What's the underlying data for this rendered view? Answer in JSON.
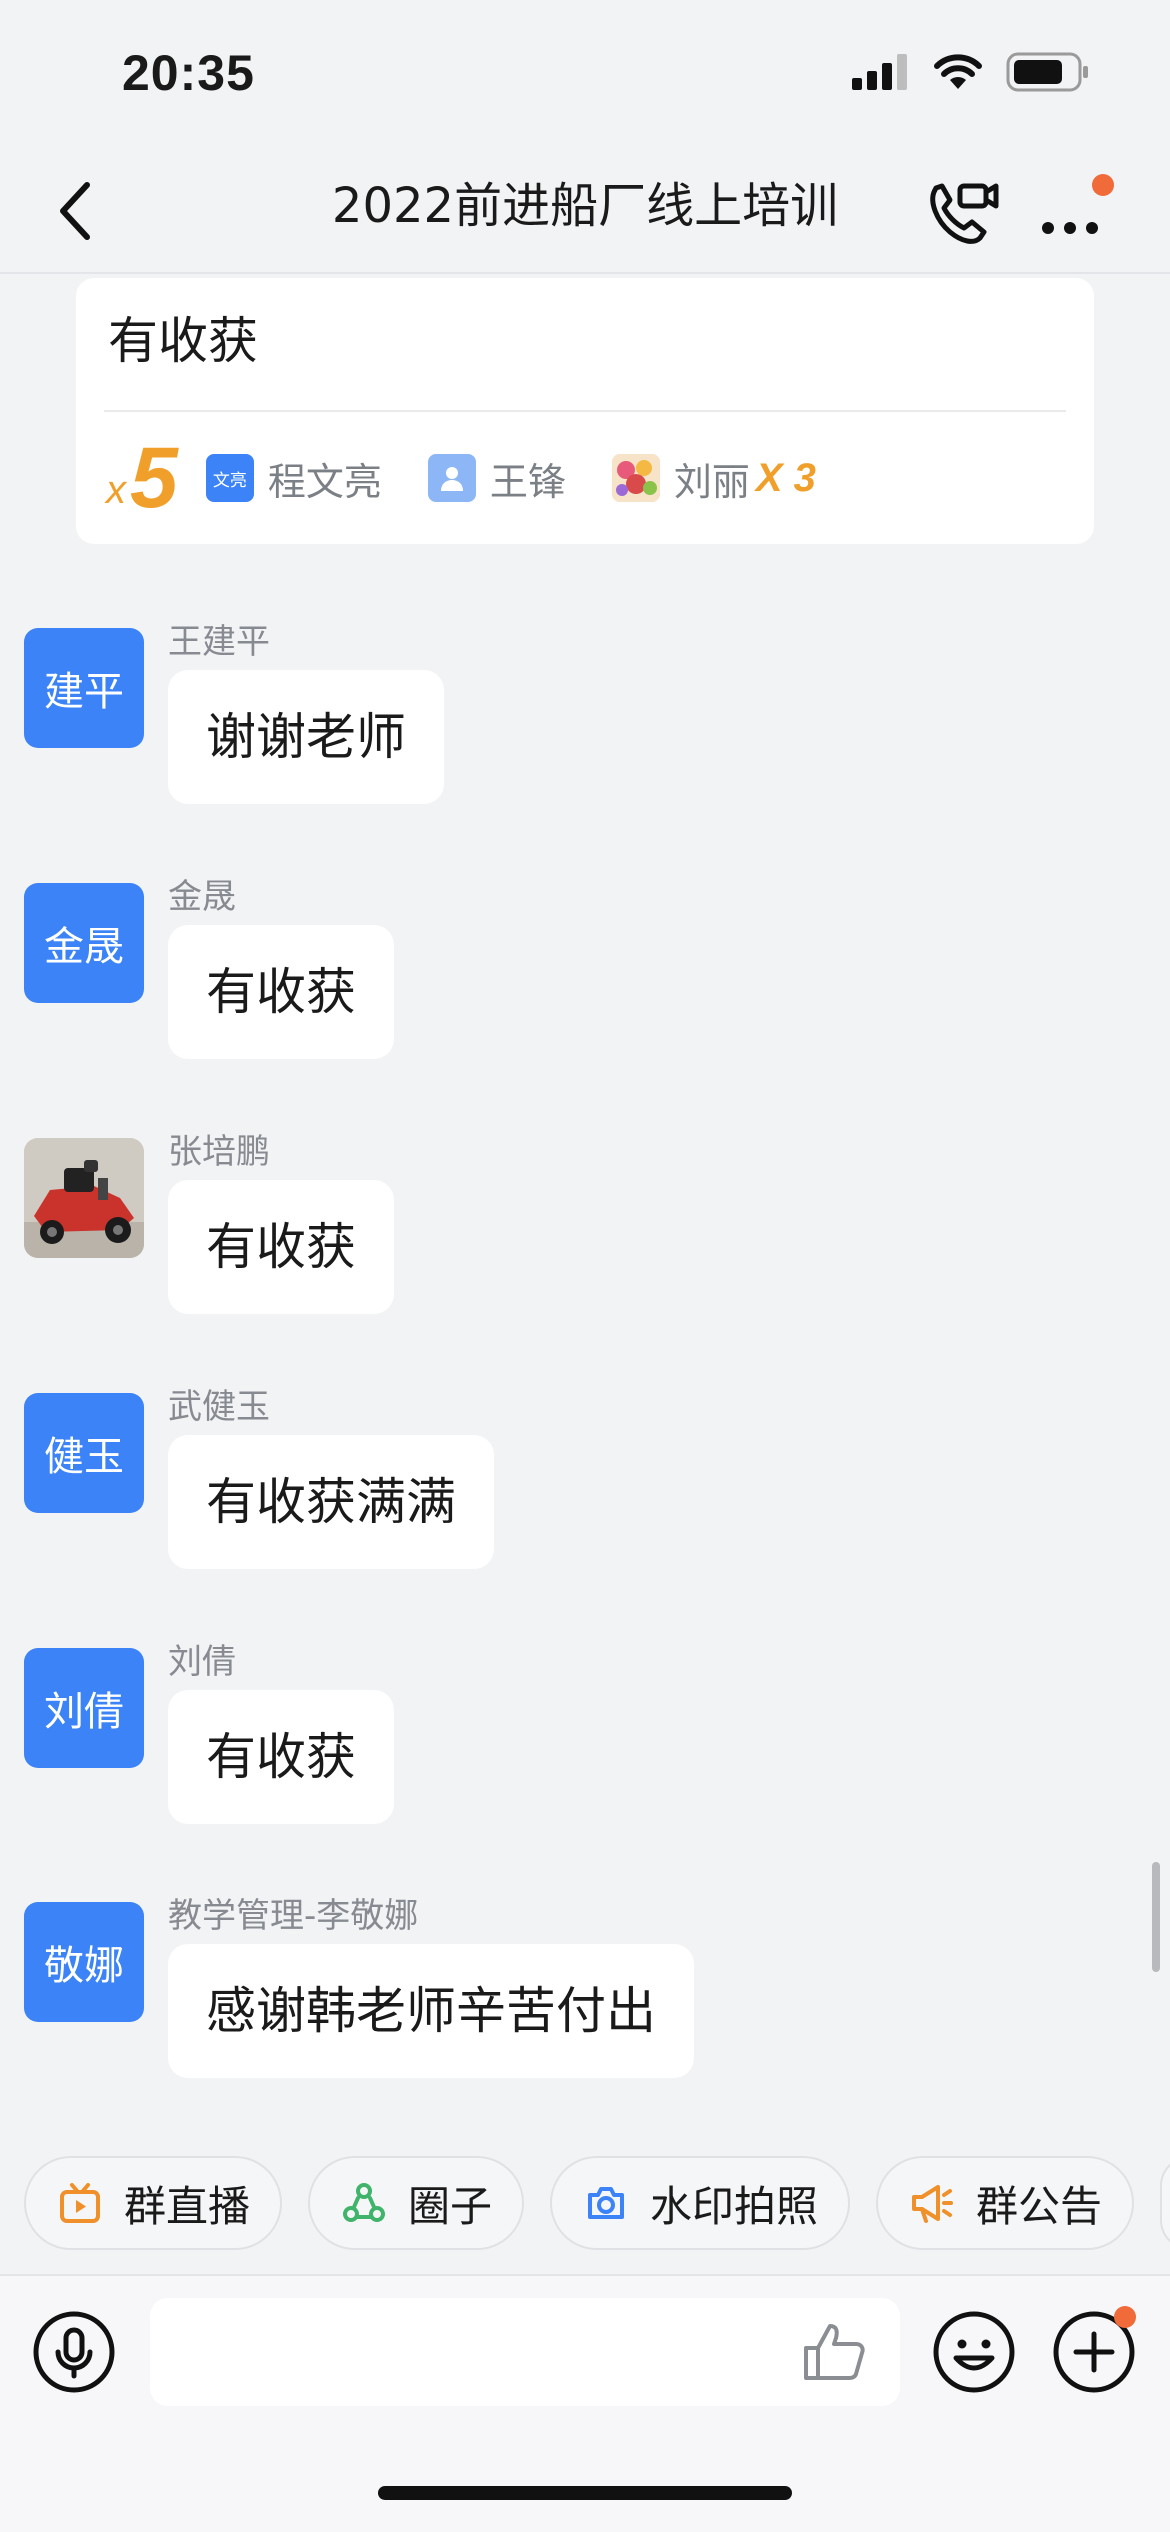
{
  "status_bar": {
    "time": "20:35"
  },
  "header": {
    "title": "2022前进船厂线上培训"
  },
  "reaction_card": {
    "message_text": "有收获",
    "count_prefix": "x",
    "count": "5",
    "reactors": [
      {
        "avatar_text": "文亮",
        "name": "程文亮",
        "extra": ""
      },
      {
        "avatar_text": "",
        "name": "王锋",
        "extra": ""
      },
      {
        "avatar_text": "",
        "name": "刘丽",
        "extra": "X 3"
      }
    ]
  },
  "messages": [
    {
      "avatar_text": "建平",
      "sender": "王建平",
      "text": "谢谢老师"
    },
    {
      "avatar_text": "金晟",
      "sender": "金晟",
      "text": "有收获"
    },
    {
      "avatar_text": "",
      "sender": "张培鹏",
      "text": "有收获"
    },
    {
      "avatar_text": "健玉",
      "sender": "武健玉",
      "text": "有收获满满"
    },
    {
      "avatar_text": "刘倩",
      "sender": "刘倩",
      "text": "有收获"
    },
    {
      "avatar_text": "敬娜",
      "sender": "教学管理-李敬娜",
      "text": "感谢韩老师辛苦付出"
    }
  ],
  "quick_actions": [
    {
      "icon": "live-tv-icon",
      "label": "群直播"
    },
    {
      "icon": "circle-group-icon",
      "label": "圈子"
    },
    {
      "icon": "camera-icon",
      "label": "水印拍照"
    },
    {
      "icon": "megaphone-icon",
      "label": "群公告"
    }
  ],
  "input_bar": {
    "placeholder": ""
  },
  "colors": {
    "accent_blue": "#3b83f6",
    "reaction_orange": "#f0a02a",
    "badge_red": "#f06a3a",
    "background": "#f2f3f5"
  }
}
